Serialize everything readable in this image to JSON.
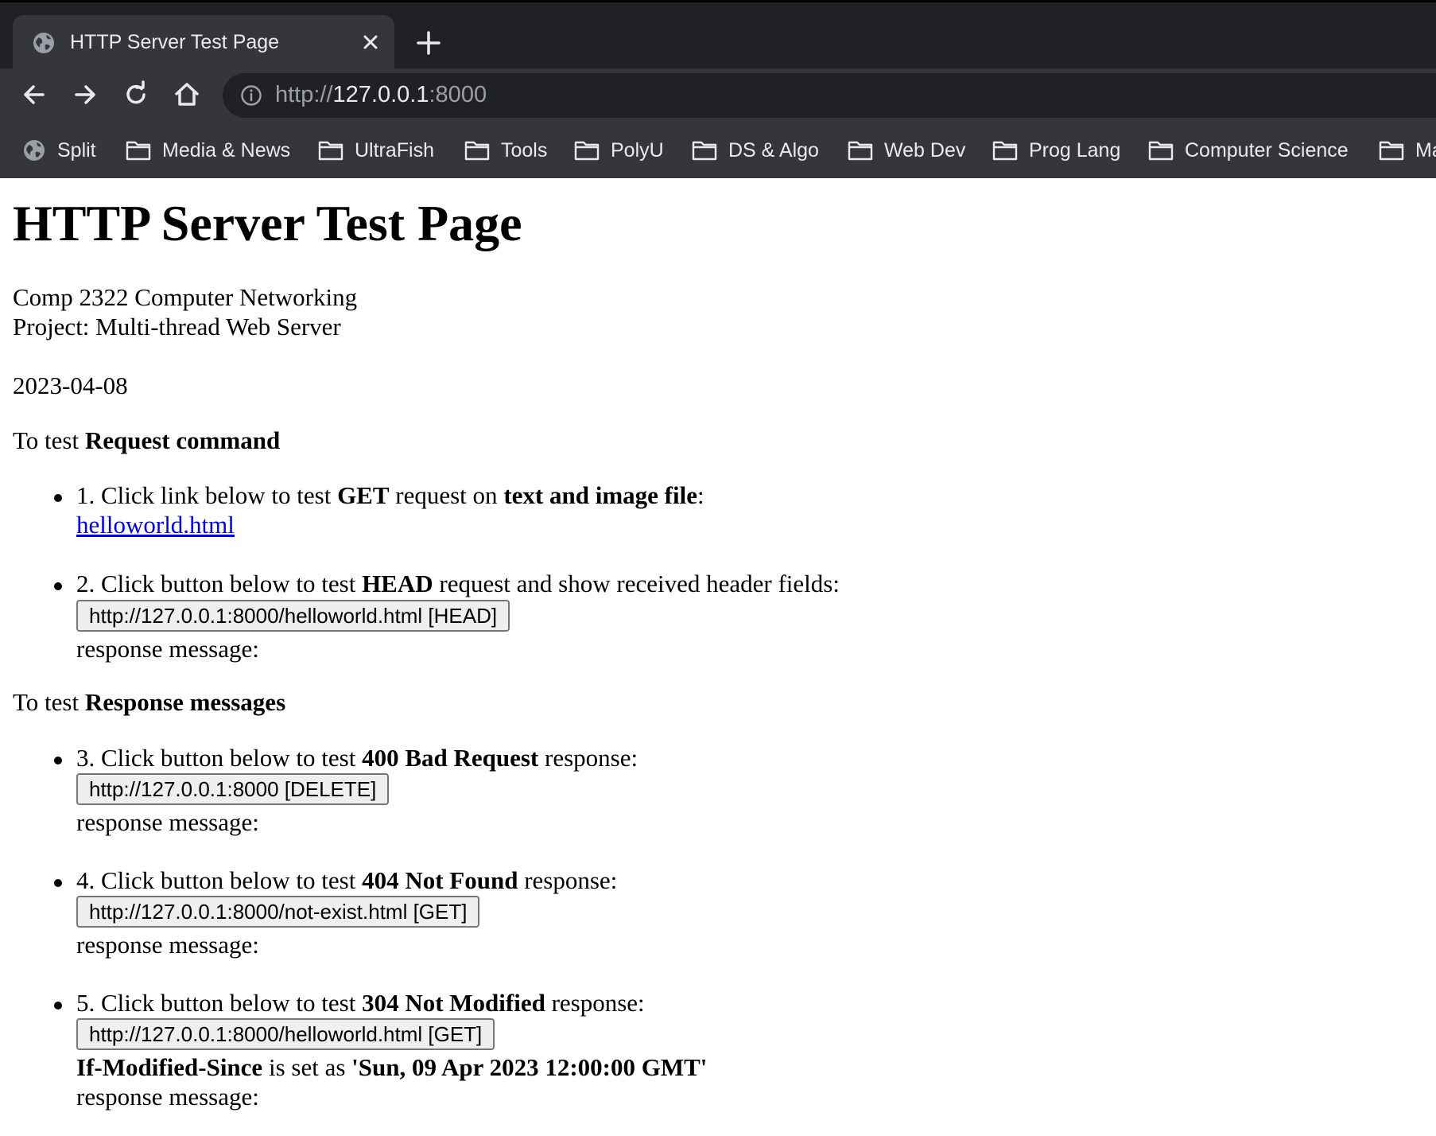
{
  "browser": {
    "tab_title": "HTTP Server Test Page",
    "url_scheme": "http://",
    "url_host": "127.0.0.1",
    "url_port": ":8000",
    "bookmarks": [
      {
        "label": "Split",
        "icon": "globe-icon"
      },
      {
        "label": "Media & News",
        "icon": "folder-icon"
      },
      {
        "label": "UltraFish",
        "icon": "folder-icon"
      },
      {
        "label": "Tools",
        "icon": "folder-icon"
      },
      {
        "label": "PolyU",
        "icon": "folder-icon"
      },
      {
        "label": "DS & Algo",
        "icon": "folder-icon"
      },
      {
        "label": "Web Dev",
        "icon": "folder-icon"
      },
      {
        "label": "Prog Lang",
        "icon": "folder-icon"
      },
      {
        "label": "Computer Science",
        "icon": "folder-icon"
      },
      {
        "label": "Ma",
        "icon": "folder-icon"
      }
    ]
  },
  "page": {
    "title": "HTTP Server Test Page",
    "course": "Comp 2322 Computer Networking",
    "project": "Project: Multi-thread Web Server",
    "date": "2023-04-08",
    "section1": {
      "prefix": "To test ",
      "bold": "Request command"
    },
    "section2": {
      "prefix": "To test ",
      "bold": "Response messages"
    },
    "items": [
      {
        "pre": "1. Click link below to test ",
        "b1": "GET",
        "mid": " request on ",
        "b2": "text and image file",
        "post": ":",
        "link": "helloworld.html"
      },
      {
        "pre": "2. Click button below to test ",
        "b1": "HEAD",
        "post": " request and show received header fields:",
        "button": "http://127.0.0.1:8000/helloworld.html [HEAD]",
        "response": "response message:"
      },
      {
        "pre": "3. Click button below to test ",
        "b1": "400 Bad Request",
        "post": " response:",
        "button": "http://127.0.0.1:8000 [DELETE]",
        "response": "response message:"
      },
      {
        "pre": "4. Click button below to test ",
        "b1": "404 Not Found",
        "post": " response:",
        "button": "http://127.0.0.1:8000/not-exist.html [GET]",
        "response": "response message:"
      },
      {
        "pre": "5. Click button below to test ",
        "b1": "304 Not Modified",
        "post": " response:",
        "button": "http://127.0.0.1:8000/helloworld.html [GET]",
        "note_b1": "If-Modified-Since",
        "note_mid": " is set as ",
        "note_b2": "'Sun, 09 Apr 2023 12:00:00 GMT'",
        "response": "response message:"
      }
    ]
  },
  "colors": {
    "chrome_dark": "#202124",
    "chrome_mid": "#35363a",
    "link": "#0000ee"
  }
}
